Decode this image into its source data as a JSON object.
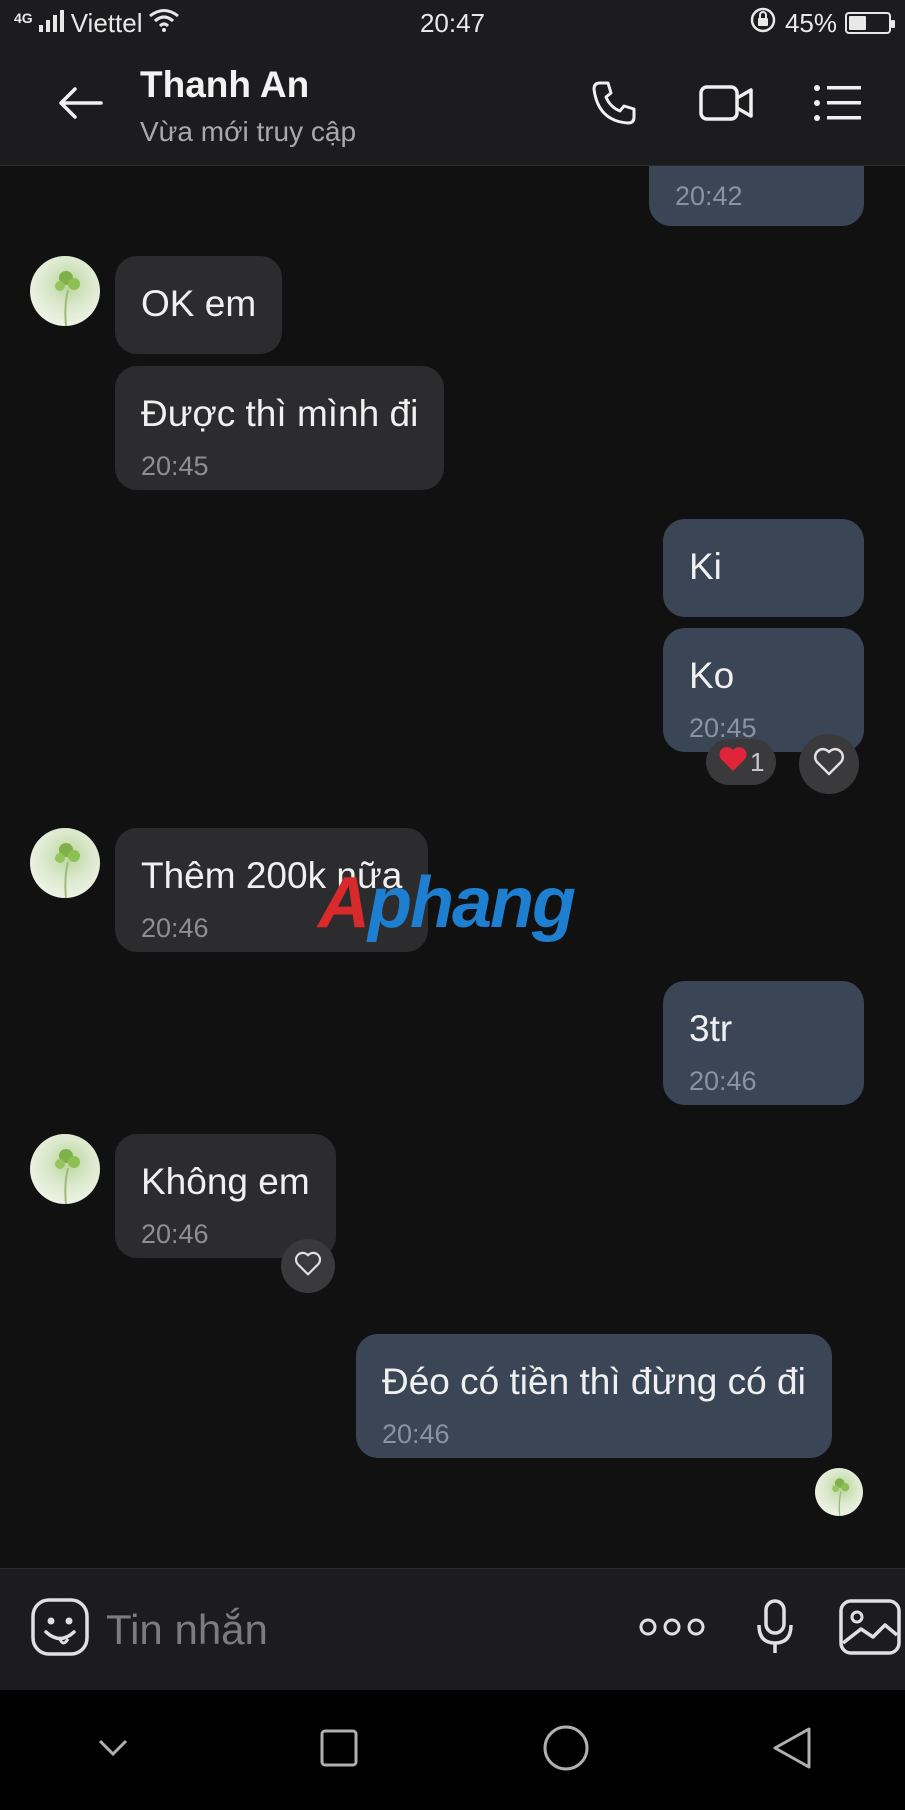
{
  "status_bar": {
    "network": "4G",
    "carrier": "Viettel",
    "time": "20:47",
    "battery_percent": "45%",
    "battery_level": 0.45
  },
  "header": {
    "contact_name": "Thanh An",
    "contact_status": "Vừa mới truy cập",
    "icons": [
      "back-arrow-icon",
      "phone-icon",
      "video-call-icon",
      "menu-list-icon"
    ]
  },
  "messages": [
    {
      "direction": "out",
      "time": "20:42"
    },
    {
      "direction": "in",
      "text": "OK em"
    },
    {
      "direction": "in",
      "text": "Được thì mình đi",
      "time": "20:45"
    },
    {
      "direction": "out",
      "text": "Ki"
    },
    {
      "direction": "out",
      "text": "Ko",
      "time": "20:45",
      "reaction_count": "1"
    },
    {
      "direction": "in",
      "text": "Thêm 200k nữa",
      "time": "20:46"
    },
    {
      "direction": "out",
      "text": "3tr",
      "time": "20:46"
    },
    {
      "direction": "in",
      "text": "Không em",
      "time": "20:46"
    },
    {
      "direction": "out",
      "text": "Đéo có tiền thì đừng có đi",
      "time": "20:46"
    }
  ],
  "watermark": {
    "first": "A",
    "rest": "phang"
  },
  "input_bar": {
    "placeholder": "Tin nhắn",
    "icons": [
      "emoji-icon",
      "more-icon",
      "microphone-icon",
      "gallery-icon"
    ]
  },
  "colors": {
    "background": "#111111",
    "incoming_bubble": "#2c2c2e",
    "outgoing_bubble": "#3a4556",
    "heart": "#e0243a"
  }
}
